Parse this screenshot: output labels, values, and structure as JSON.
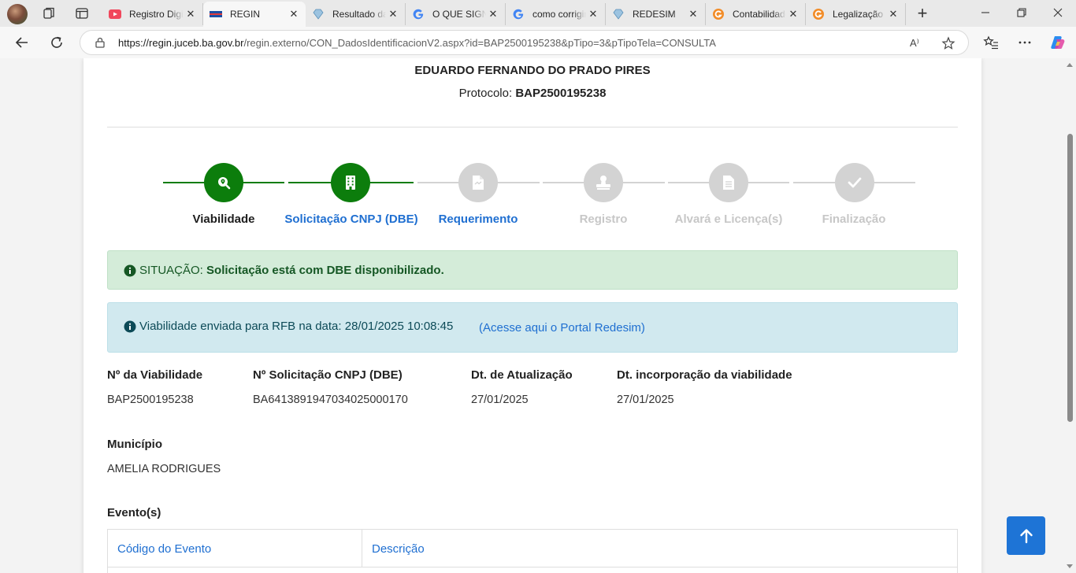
{
  "browser": {
    "tabs": [
      {
        "title": "Registro Digital",
        "favicon": "youtube-icon",
        "active": false
      },
      {
        "title": "REGIN",
        "favicon": "regin-icon",
        "active": true
      },
      {
        "title": "Resultado da pesquisa",
        "favicon": "diamond-icon",
        "active": false
      },
      {
        "title": "O QUE SIGNIFICA",
        "favicon": "google-icon",
        "active": false
      },
      {
        "title": "como corrigir",
        "favicon": "google-icon",
        "active": false
      },
      {
        "title": "REDESIM",
        "favicon": "diamond-icon",
        "active": false
      },
      {
        "title": "Contabilidade",
        "favicon": "g-orange-icon",
        "active": false
      },
      {
        "title": "Legalização",
        "favicon": "g-orange-icon",
        "active": false
      }
    ],
    "url_host": "https://regin.juceb.ba.gov.br",
    "url_path": "/regin.externo/CON_DadosIdentificacionV2.aspx?id=BAP2500195238&pTipo=3&pTipoTela=CONSULTA",
    "read_aloud_label": "A⁾"
  },
  "page": {
    "company_name": "EDUARDO FERNANDO DO PRADO PIRES",
    "protocol_label": "Protocolo:",
    "protocol_value": "BAP2500195238",
    "steps": [
      {
        "label": "Viabilidade",
        "state": "done",
        "icon": "search-location-icon"
      },
      {
        "label": "Solicitação CNPJ (DBE)",
        "state": "done",
        "icon": "building-icon"
      },
      {
        "label": "Requerimento",
        "state": "todo",
        "icon": "document-icon"
      },
      {
        "label": "Registro",
        "state": "todo",
        "icon": "stamp-icon"
      },
      {
        "label": "Alvará e Licença(s)",
        "state": "todo",
        "icon": "file-text-icon"
      },
      {
        "label": "Finalização",
        "state": "todo",
        "icon": "check-icon"
      }
    ],
    "situation_label": "SITUAÇÃO:",
    "situation_text": "Solicitação está com DBE disponibilizado.",
    "rfb_text": "Viabilidade enviada para RFB na data: 28/01/2025 10:08:45",
    "rfb_link": "(Acesse aqui o Portal Redesim)",
    "fields": {
      "viabilidade_label": "Nº da Viabilidade",
      "viabilidade_value": "BAP2500195238",
      "cnpj_label": "Nº Solicitação CNPJ (DBE)",
      "cnpj_value": "BA64138919470340250001​70",
      "atualizacao_label": "Dt. de Atualização",
      "atualizacao_value": "27/01/2025",
      "incorporacao_label": "Dt. incorporação da viabilidade",
      "incorporacao_value": "27/01/2025",
      "municipio_label": "Município",
      "municipio_value": "AMELIA RODRIGUES"
    },
    "events_title": "Evento(s)",
    "events_columns": [
      "Código do Evento",
      "Descrição"
    ]
  },
  "colors": {
    "step_done": "#0c7d0c",
    "step_todo": "#d3d3d3",
    "link_blue": "#1f6fd1",
    "success_bg": "#d4ecd9",
    "info_bg": "#d1e9ef",
    "to_top_button": "#1e74d6"
  }
}
